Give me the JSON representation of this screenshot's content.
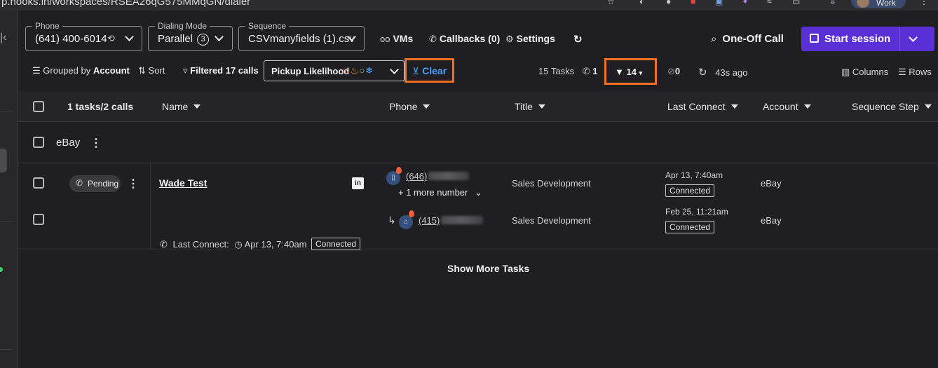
{
  "browser": {
    "url_fragment": "p.hooks.in/workspaces/RSEA26qG575MMqGN/dialer",
    "profile_label": "Work"
  },
  "toolbar": {
    "phone": {
      "legend": "Phone",
      "value": "(641) 400-6014"
    },
    "dialing_mode": {
      "legend": "Dialing Mode",
      "value": "Parallel",
      "count": "3"
    },
    "sequence": {
      "legend": "Sequence",
      "value": "CSVmanyfields (1).csv"
    },
    "vms_label": "VMs",
    "callbacks_label": "Callbacks (0)",
    "settings_label": "Settings",
    "one_off_label": "One-Off Call",
    "start_session_label": "Start session"
  },
  "filters": {
    "grouped_prefix": "Grouped by",
    "grouped_value": "Account",
    "sort_label": "Sort",
    "filtered_label": "Filtered 17 calls",
    "pickup_label": "Pickup Likelihood",
    "clear_label": "Clear",
    "tasks_count": "15 Tasks",
    "calls_count": "1",
    "filter_count": "14",
    "hidden_count": "0",
    "refresh_ago": "43s ago",
    "columns_label": "Columns",
    "rows_label": "Rows"
  },
  "table": {
    "selection_summary": "1 tasks/2 calls",
    "headers": {
      "name": "Name",
      "phone": "Phone",
      "title": "Title",
      "last_connect": "Last Connect",
      "account": "Account",
      "sequence_step": "Sequence Step"
    },
    "group": {
      "label": "eBay"
    },
    "task": {
      "status": "Pending",
      "name": "Wade Test",
      "last_connect_prefix": "Last Connect:",
      "last_connect_time": "Apr 13, 7:40am",
      "last_connect_status": "Connected",
      "more_numbers": "+ 1 more number",
      "calls": [
        {
          "phone": "(646)",
          "title": "Sales Development",
          "last_connect": "Apr 13, 7:40am",
          "status": "Connected",
          "account": "eBay"
        },
        {
          "phone": "(415)",
          "title": "Sales Development",
          "last_connect": "Feb 25, 11:21am",
          "status": "Connected",
          "account": "eBay"
        }
      ]
    },
    "show_more_label": "Show More Tasks"
  },
  "colors": {
    "accent_purple": "#5b2fd6",
    "highlight_orange": "#f36f25",
    "link_blue": "#4ea2ff",
    "background": "#1f1f21"
  }
}
